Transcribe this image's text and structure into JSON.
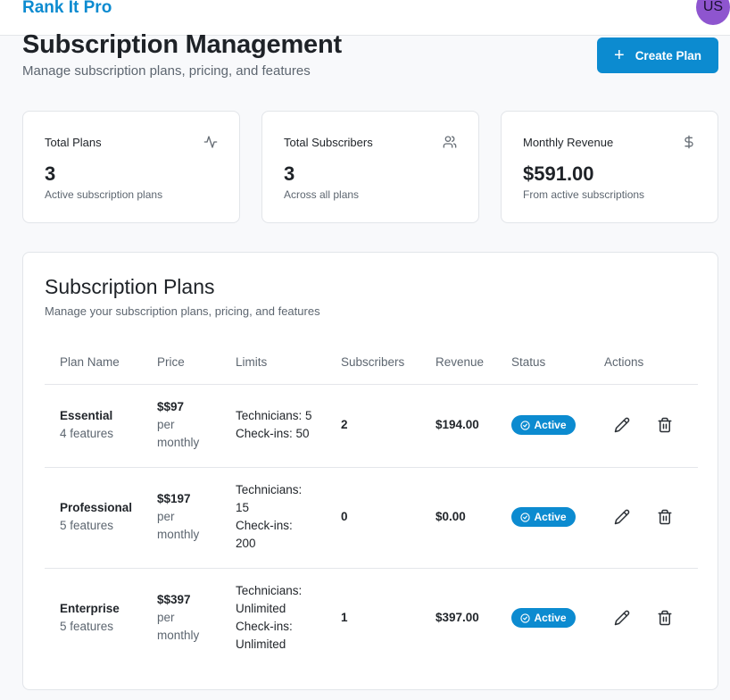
{
  "app": {
    "brand": "Rank It Pro",
    "avatar_initials": "US"
  },
  "header": {
    "title": "Subscription Management",
    "subtitle": "Manage subscription plans, pricing, and features",
    "create_button": "Create Plan"
  },
  "stats": [
    {
      "label": "Total Plans",
      "value": "3",
      "sub": "Active subscription plans",
      "icon": "activity-icon"
    },
    {
      "label": "Total Subscribers",
      "value": "3",
      "sub": "Across all plans",
      "icon": "users-icon"
    },
    {
      "label": "Monthly Revenue",
      "value": "$591.00",
      "sub": "From active subscriptions",
      "icon": "dollar-icon"
    }
  ],
  "plans_section": {
    "title": "Subscription Plans",
    "subtitle": "Manage your subscription plans, pricing, and features",
    "columns": [
      "Plan Name",
      "Price",
      "Limits",
      "Subscribers",
      "Revenue",
      "Status",
      "Actions"
    ],
    "rows": [
      {
        "name": "Essential",
        "features": "4 features",
        "price": "$$97",
        "per": "per",
        "period": "monthly",
        "limits": [
          "Technicians: 5",
          "Check-ins: 50"
        ],
        "subscribers": "2",
        "revenue": "$194.00",
        "status": "Active"
      },
      {
        "name": "Professional",
        "features": "5 features",
        "price": "$$197",
        "per": "per",
        "period": "monthly",
        "limits": [
          "Technicians:",
          "15",
          "Check-ins:",
          "200"
        ],
        "subscribers": "0",
        "revenue": "$0.00",
        "status": "Active"
      },
      {
        "name": "Enterprise",
        "features": "5 features",
        "price": "$$397",
        "per": "per",
        "period": "monthly",
        "limits": [
          "Technicians:",
          "Unlimited",
          "Check-ins:",
          "Unlimited"
        ],
        "subscribers": "1",
        "revenue": "$397.00",
        "status": "Active"
      }
    ]
  },
  "colors": {
    "accent": "#0c8bd0",
    "avatar": "#8e55cf"
  }
}
